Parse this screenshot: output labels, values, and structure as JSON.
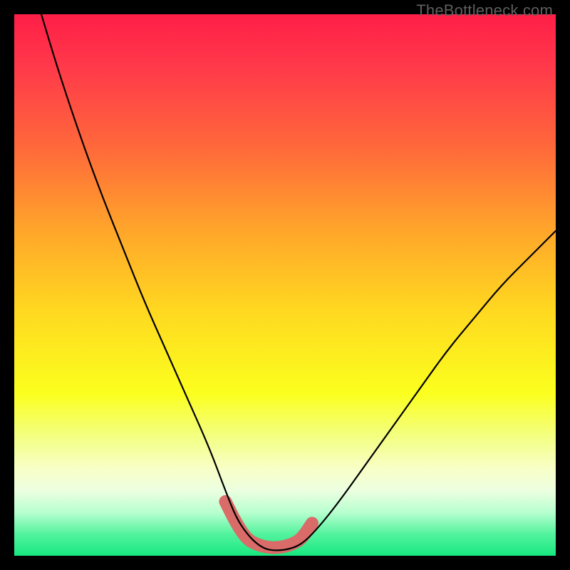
{
  "watermark": "TheBottleneck.com",
  "chart_data": {
    "type": "line",
    "title": "",
    "xlabel": "",
    "ylabel": "",
    "xlim": [
      0,
      100
    ],
    "ylim": [
      0,
      100
    ],
    "grid": false,
    "legend": false,
    "series": [
      {
        "name": "curve",
        "x": [
          5,
          8,
          12,
          16,
          20,
          24,
          28,
          32,
          36,
          39,
          41,
          43,
          45,
          47,
          50,
          53,
          56,
          60,
          65,
          70,
          75,
          80,
          85,
          90,
          95,
          100
        ],
        "values": [
          100,
          90,
          78,
          67,
          57,
          47,
          38,
          29,
          20,
          12,
          7,
          4,
          2,
          1,
          1,
          2,
          5,
          10,
          17,
          24,
          31,
          38,
          44,
          50,
          55,
          60
        ]
      },
      {
        "name": "highlight",
        "x": [
          39,
          41,
          43,
          45,
          47,
          49,
          51,
          53,
          55
        ],
        "values": [
          10,
          6,
          3,
          2,
          1.5,
          1.5,
          2,
          3,
          6
        ]
      }
    ],
    "background_gradient": {
      "stops": [
        {
          "pos": 0.0,
          "color": "#ff1e47"
        },
        {
          "pos": 0.1,
          "color": "#ff3a4a"
        },
        {
          "pos": 0.25,
          "color": "#ff6a3a"
        },
        {
          "pos": 0.4,
          "color": "#ffa62a"
        },
        {
          "pos": 0.55,
          "color": "#ffd920"
        },
        {
          "pos": 0.7,
          "color": "#fbff1e"
        },
        {
          "pos": 0.78,
          "color": "#f3ff82"
        },
        {
          "pos": 0.84,
          "color": "#f8ffc8"
        },
        {
          "pos": 0.88,
          "color": "#ecffe0"
        },
        {
          "pos": 0.92,
          "color": "#b7ffcf"
        },
        {
          "pos": 0.96,
          "color": "#53f39e"
        },
        {
          "pos": 1.0,
          "color": "#17e880"
        }
      ]
    },
    "colors": {
      "curve": "#000000",
      "highlight": "#d96b68"
    }
  }
}
